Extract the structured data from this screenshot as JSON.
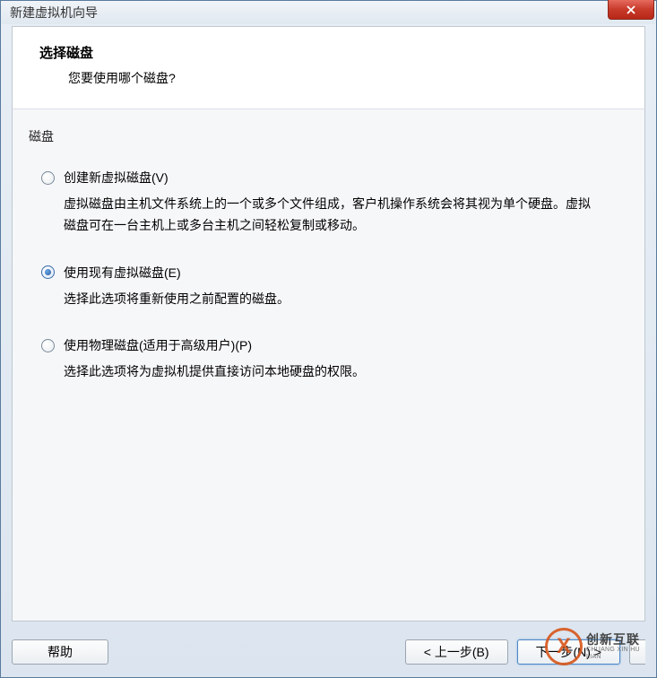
{
  "window": {
    "title": "新建虚拟机向导"
  },
  "header": {
    "title": "选择磁盘",
    "subtitle": "您要使用哪个磁盘?"
  },
  "group": {
    "label": "磁盘"
  },
  "options": [
    {
      "label": "创建新虚拟磁盘(V)",
      "description": "虚拟磁盘由主机文件系统上的一个或多个文件组成，客户机操作系统会将其视为单个硬盘。虚拟磁盘可在一台主机上或多台主机之间轻松复制或移动。",
      "selected": false
    },
    {
      "label": "使用现有虚拟磁盘(E)",
      "description": "选择此选项将重新使用之前配置的磁盘。",
      "selected": true
    },
    {
      "label": "使用物理磁盘(适用于高级用户)(P)",
      "description": "选择此选项将为虚拟机提供直接访问本地硬盘的权限。",
      "selected": false
    }
  ],
  "buttons": {
    "help": "帮助",
    "back": "< 上一步(B)",
    "next": "下一步(N) >"
  },
  "watermark": {
    "cn": "创新互联",
    "en": "CHUANG XIN HU LIAN"
  }
}
